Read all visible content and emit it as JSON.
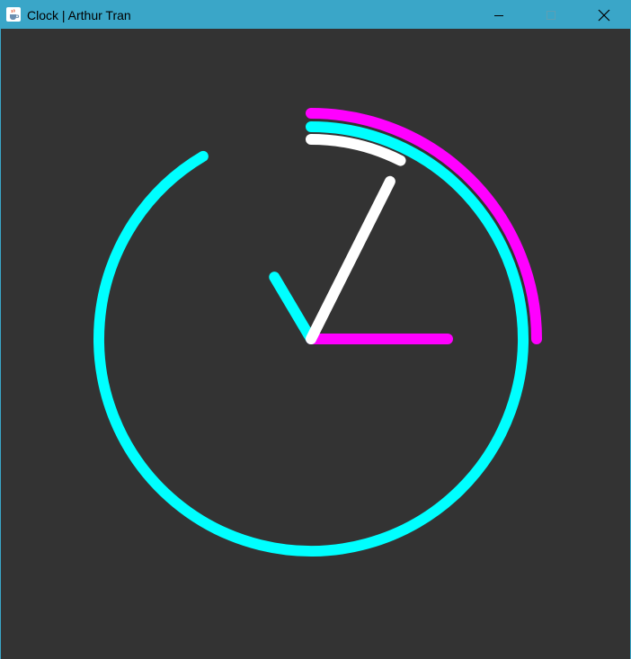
{
  "window": {
    "title": "Clock | Arthur Tran",
    "app_icon": "java-coffee-cup-icon",
    "controls": {
      "minimize_icon": "minimize-icon",
      "maximize_icon": "maximize-icon",
      "close_icon": "close-icon"
    }
  },
  "colors": {
    "titlebar": "#3aa6c8",
    "background": "#333333",
    "hours": "#00ffff",
    "minutes": "#ffffff",
    "seconds": "#ff00ff"
  },
  "clock": {
    "hour_hand_icon": "hour-hand",
    "minute_hand_icon": "minute-hand",
    "second_hand_icon": "second-hand",
    "hour_arc_fraction": 0.915,
    "minute_arc_fraction": 0.074,
    "second_arc_fraction": 0.25
  }
}
